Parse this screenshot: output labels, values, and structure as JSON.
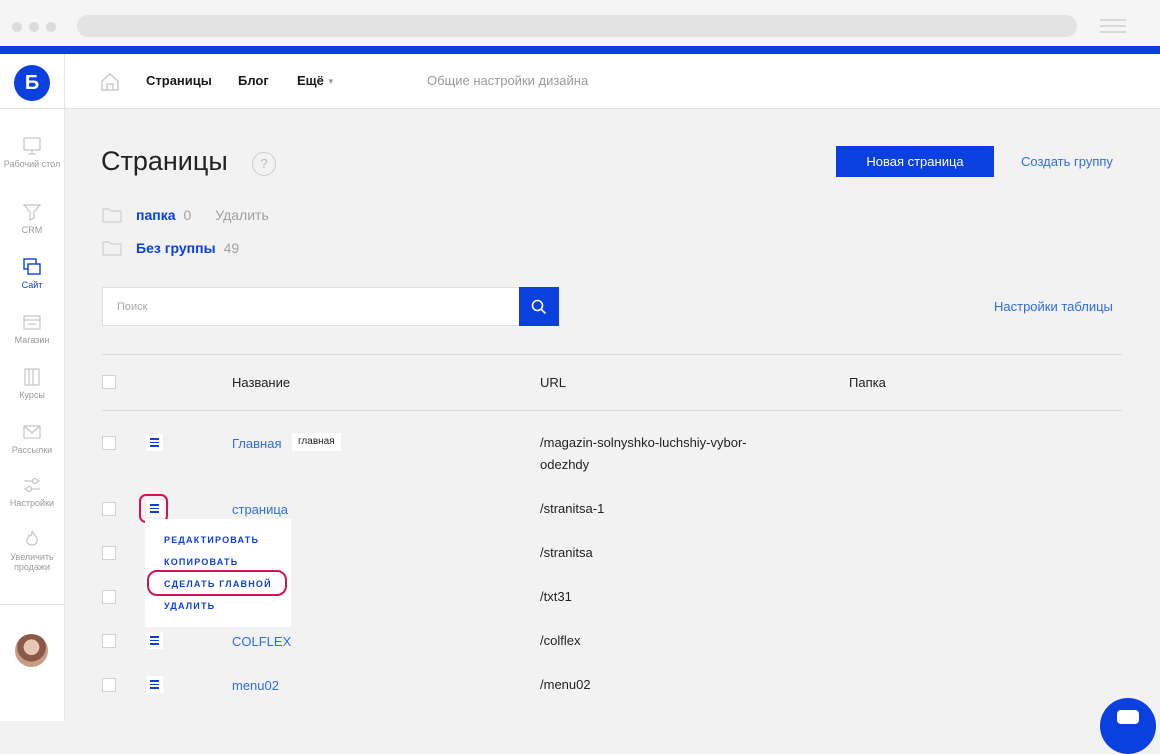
{
  "colors": {
    "accent": "#0a3fe0",
    "link": "#2f6de0",
    "highlight": "#d1134f"
  },
  "sidebar": {
    "logo": "Б",
    "items": [
      {
        "label": "Рабочий стол",
        "icon": "monitor-icon"
      },
      {
        "label": "CRM",
        "icon": "funnel-icon"
      },
      {
        "label": "Сайт",
        "icon": "windows-icon",
        "active": true
      },
      {
        "label": "Магазин",
        "icon": "store-icon"
      },
      {
        "label": "Курсы",
        "icon": "book-icon"
      },
      {
        "label": "Рассылки",
        "icon": "envelope-icon"
      },
      {
        "label": "Настройки",
        "icon": "sliders-icon"
      },
      {
        "label": "Увеличить продажи",
        "icon": "flame-icon"
      }
    ]
  },
  "topbar": {
    "nav": [
      "Страницы",
      "Блог",
      "Ещё"
    ],
    "design_settings": "Общие настройки дизайна"
  },
  "page": {
    "title": "Страницы",
    "help": "?",
    "new_page_button": "Новая страница",
    "create_group_link": "Создать группу"
  },
  "folders": [
    {
      "name": "папка",
      "count": "0",
      "delete": "Удалить"
    },
    {
      "name": "Без группы",
      "count": "49"
    }
  ],
  "search": {
    "placeholder": "Поиск"
  },
  "table_settings": "Настройки таблицы",
  "table": {
    "headers": {
      "name": "Название",
      "url": "URL",
      "folder": "Папка"
    },
    "rows": [
      {
        "name": "Главная",
        "badge": "главная",
        "url_line1": "/magazin-solnyshko-luchshiy-vybor-",
        "url_line2": "odezhdy"
      },
      {
        "name": "страница",
        "url": "/stranitsa-1"
      },
      {
        "name": "",
        "url": "/stranitsa"
      },
      {
        "name": "",
        "url": "/txt31"
      },
      {
        "name": "COLFLEX",
        "url": "/colflex"
      },
      {
        "name": "menu02",
        "url": "/menu02"
      }
    ]
  },
  "row_menu": {
    "items": [
      "РЕДАКТИРОВАТЬ",
      "КОПИРОВАТЬ",
      "СДЕЛАТЬ ГЛАВНОЙ",
      "УДАЛИТЬ"
    ]
  }
}
